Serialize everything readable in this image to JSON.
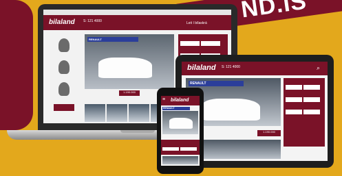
{
  "headline_fragment": "ND.IS",
  "brand": {
    "logo": "bilaland",
    "phone_top": "S: 121 4000",
    "accent": "#7a1228",
    "background": "#e3a81c"
  },
  "promo": "RENAULT",
  "price_tag": "1.190.000",
  "nav_labels": [
    "Leit í bílaskrá"
  ],
  "devices": [
    "laptop",
    "tablet",
    "phone"
  ]
}
